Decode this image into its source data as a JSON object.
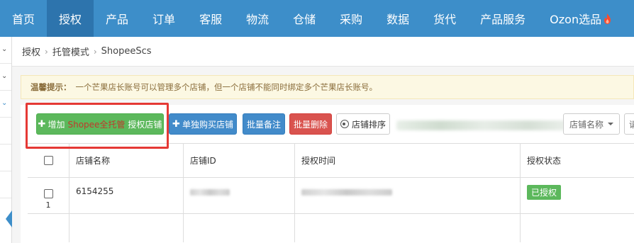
{
  "nav": {
    "items": [
      "首页",
      "授权",
      "产品",
      "订单",
      "客服",
      "物流",
      "仓储",
      "采购",
      "数据",
      "货代",
      "产品服务",
      "Ozon选品"
    ],
    "active_index": 1,
    "ozon_icon": "flame-icon",
    "color": "#3d8ec9"
  },
  "breadcrumb": {
    "level1": "授权",
    "level2": "托管模式",
    "level3": "ShopeeScs"
  },
  "tip": {
    "label": "温馨提示：",
    "text": "一个芒果店长账号可以管理多个店铺，但一个店铺不能同时绑定多个芒果店长账号。"
  },
  "toolbar": {
    "add_prefix": "增加",
    "add_highlight": "Shopee全托管",
    "add_suffix": "授权店铺",
    "buy_single": "单独购买店铺",
    "batch_note": "批量备注",
    "batch_delete": "批量删除",
    "sort_shops": "店铺排序",
    "shop_name_select": "店铺名称",
    "cut_field": "请"
  },
  "table": {
    "headers": {
      "shop_name": "店铺名称",
      "shop_id": "店铺ID",
      "auth_time": "授权时间",
      "auth_status": "授权状态"
    },
    "rows": [
      {
        "row_number": "1",
        "shop_name": "6154255",
        "auth_status": "已授权"
      }
    ]
  }
}
